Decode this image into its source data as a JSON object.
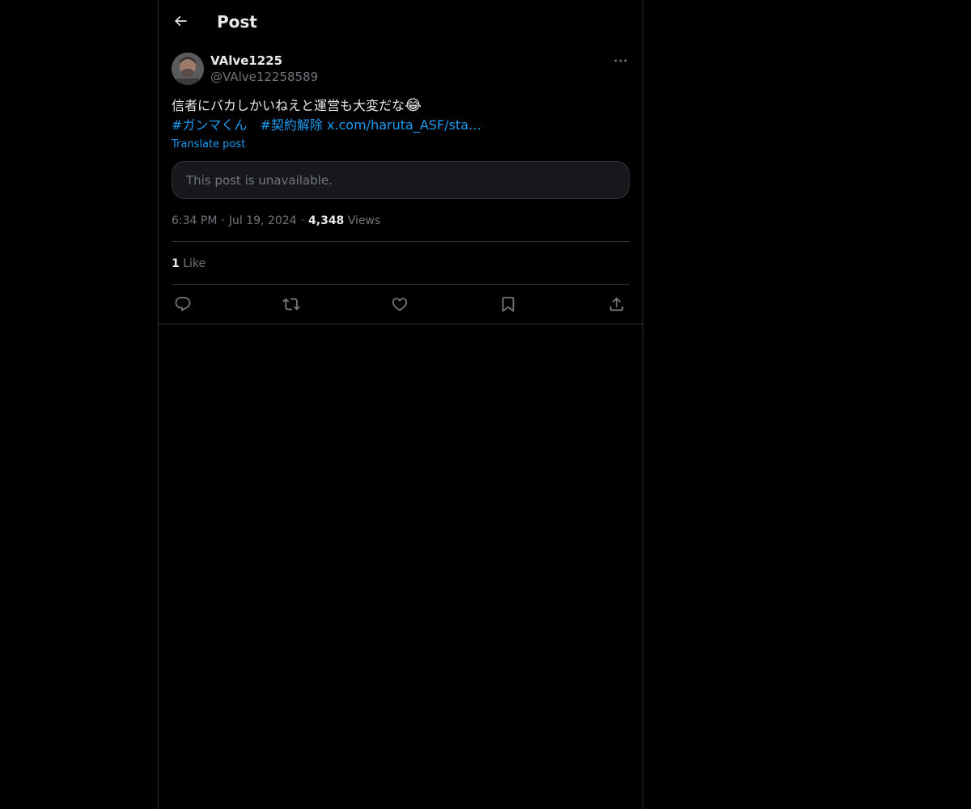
{
  "header": {
    "back_icon": "arrow-left-icon",
    "title": "Post"
  },
  "author": {
    "display_name": "VAlve1225",
    "handle": "@VAlve12258589",
    "more_icon": "more-horizontal-icon"
  },
  "post": {
    "text": "信者にバカしかいねえと運営も大変だな",
    "emoji": "😂",
    "hashtag1": "#ガンマくん",
    "hashtag2": "#契約解除",
    "link": "x.com/haruta_ASF/sta…",
    "translate_label": "Translate post",
    "embedded_notice": "This post is unavailable."
  },
  "meta": {
    "time": "6:34 PM",
    "separator": "·",
    "date": "Jul 19, 2024",
    "views_count": "4,348",
    "views_label": "Views"
  },
  "engagement": {
    "like_count": "1",
    "like_label": "Like"
  },
  "actions": [
    {
      "name": "reply-icon"
    },
    {
      "name": "repost-icon"
    },
    {
      "name": "like-icon"
    },
    {
      "name": "bookmark-icon"
    },
    {
      "name": "share-icon"
    }
  ],
  "colors": {
    "background": "#000000",
    "text": "#e7e9ea",
    "secondary_text": "#71767b",
    "accent": "#1d9bf0",
    "border": "#2f3336"
  }
}
